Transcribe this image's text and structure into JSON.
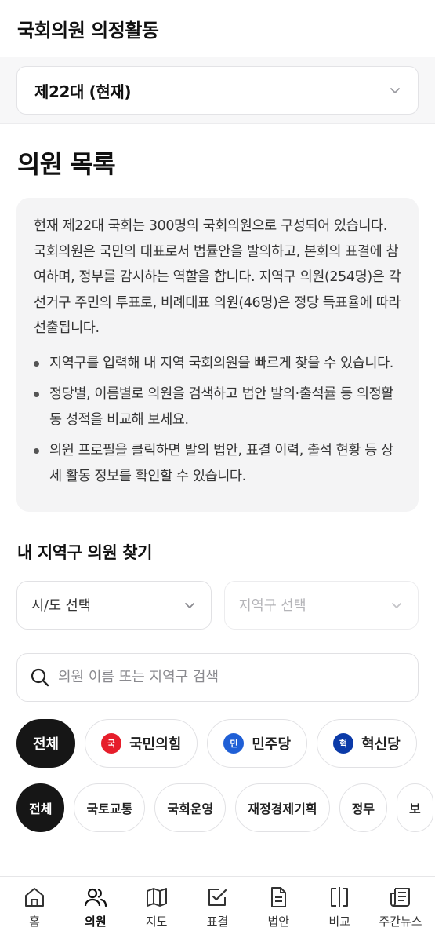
{
  "header": {
    "title": "국회의원 의정활동"
  },
  "session_select": {
    "value": "제22대 (현재)"
  },
  "section": {
    "title": "의원 목록"
  },
  "info": {
    "paragraph": "현재 제22대 국회는 300명의 국회의원으로 구성되어 있습니다. 국회의원은 국민의 대표로서 법률안을 발의하고, 본회의 표결에 참여하며, 정부를 감시하는 역할을 합니다. 지역구 의원(254명)은 각 선거구 주민의 투표로, 비례대표 의원(46명)은 정당 득표율에 따라 선출됩니다.",
    "bullets": [
      "지역구를 입력해 내 지역 국회의원을 빠르게 찾을 수 있습니다.",
      "정당별, 이름별로 의원을 검색하고 법안 발의·출석률 등 의정활동 성적을 비교해 보세요.",
      "의원 프로필을 클릭하면 발의 법안, 표결 이력, 출석 현황 등 상세 활동 정보를 확인할 수 있습니다."
    ]
  },
  "district": {
    "title": "내 지역구 의원 찾기",
    "sido_placeholder": "시/도 선택",
    "district_placeholder": "지역구 선택"
  },
  "search": {
    "placeholder": "의원 이름 또는 지역구 검색"
  },
  "party_filters": [
    {
      "label": "전체",
      "active": true
    },
    {
      "label": "국민의힘",
      "badge": "국",
      "color": "#e61e2b"
    },
    {
      "label": "민주당",
      "badge": "민",
      "color": "#1f5fd6"
    },
    {
      "label": "혁신당",
      "badge": "혁",
      "color": "#0b3aa8"
    }
  ],
  "committee_filters": [
    "전체",
    "국토교통",
    "국회운영",
    "재정경제기획",
    "정무",
    "보"
  ],
  "bottom_nav": [
    {
      "label": "홈",
      "icon": "home-icon"
    },
    {
      "label": "의원",
      "icon": "users-icon",
      "active": true
    },
    {
      "label": "지도",
      "icon": "map-icon"
    },
    {
      "label": "표결",
      "icon": "vote-check-icon"
    },
    {
      "label": "법안",
      "icon": "document-icon"
    },
    {
      "label": "비교",
      "icon": "compare-icon"
    },
    {
      "label": "주간뉴스",
      "icon": "newspaper-icon"
    }
  ]
}
